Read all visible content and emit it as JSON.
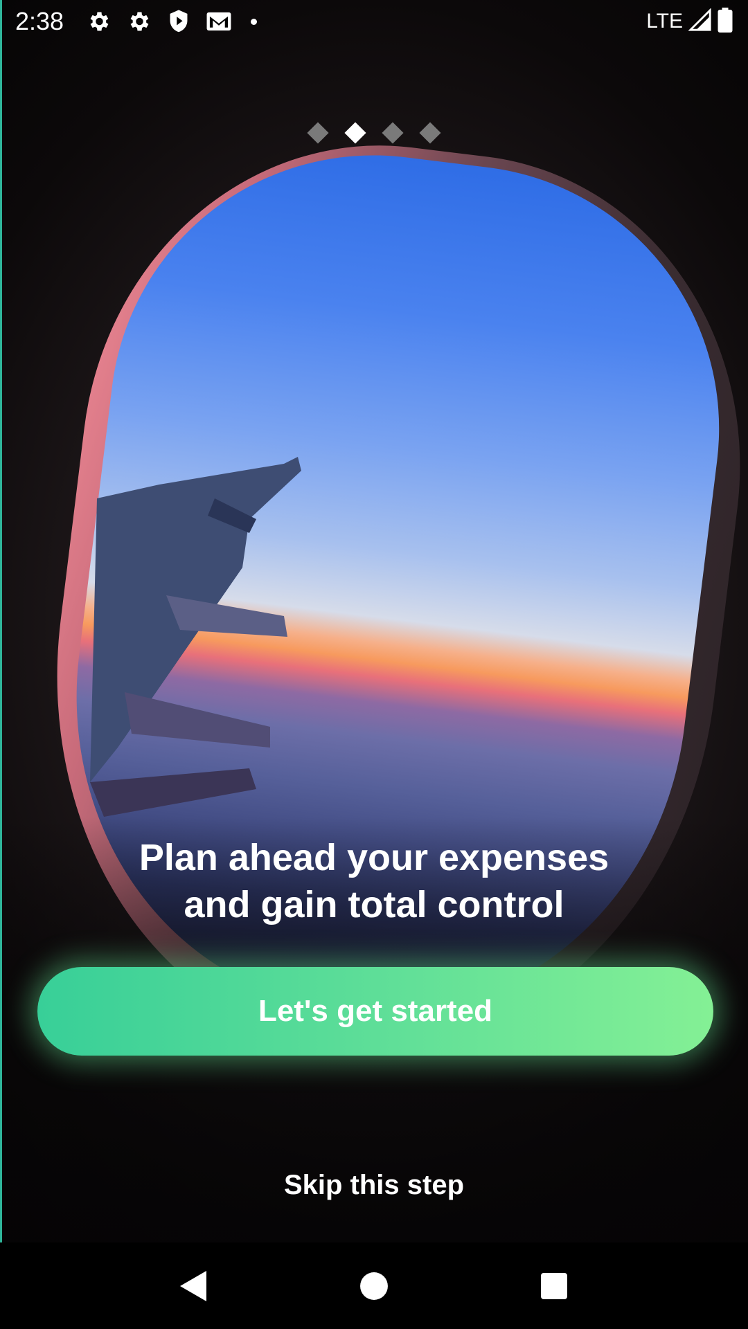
{
  "status_bar": {
    "time": "2:38",
    "network": "LTE",
    "icons": [
      "settings-icon",
      "settings-icon",
      "shield-play-icon",
      "gmail-icon",
      "notification-dot",
      "signal-icon",
      "battery-icon"
    ]
  },
  "onboarding": {
    "pager": {
      "total": 4,
      "active_index": 1
    },
    "headline_line1": "Plan ahead your expenses",
    "headline_line2": "and gain total control",
    "cta_label": "Let's get started",
    "skip_label": "Skip this step"
  },
  "colors": {
    "cta_gradient_start": "#38cf98",
    "cta_gradient_end": "#84f095",
    "pager_active": "#ffffff",
    "pager_inactive": "#7a7a7a"
  },
  "nav_bar": {
    "icons": [
      "back-icon",
      "home-icon",
      "recents-icon"
    ]
  }
}
